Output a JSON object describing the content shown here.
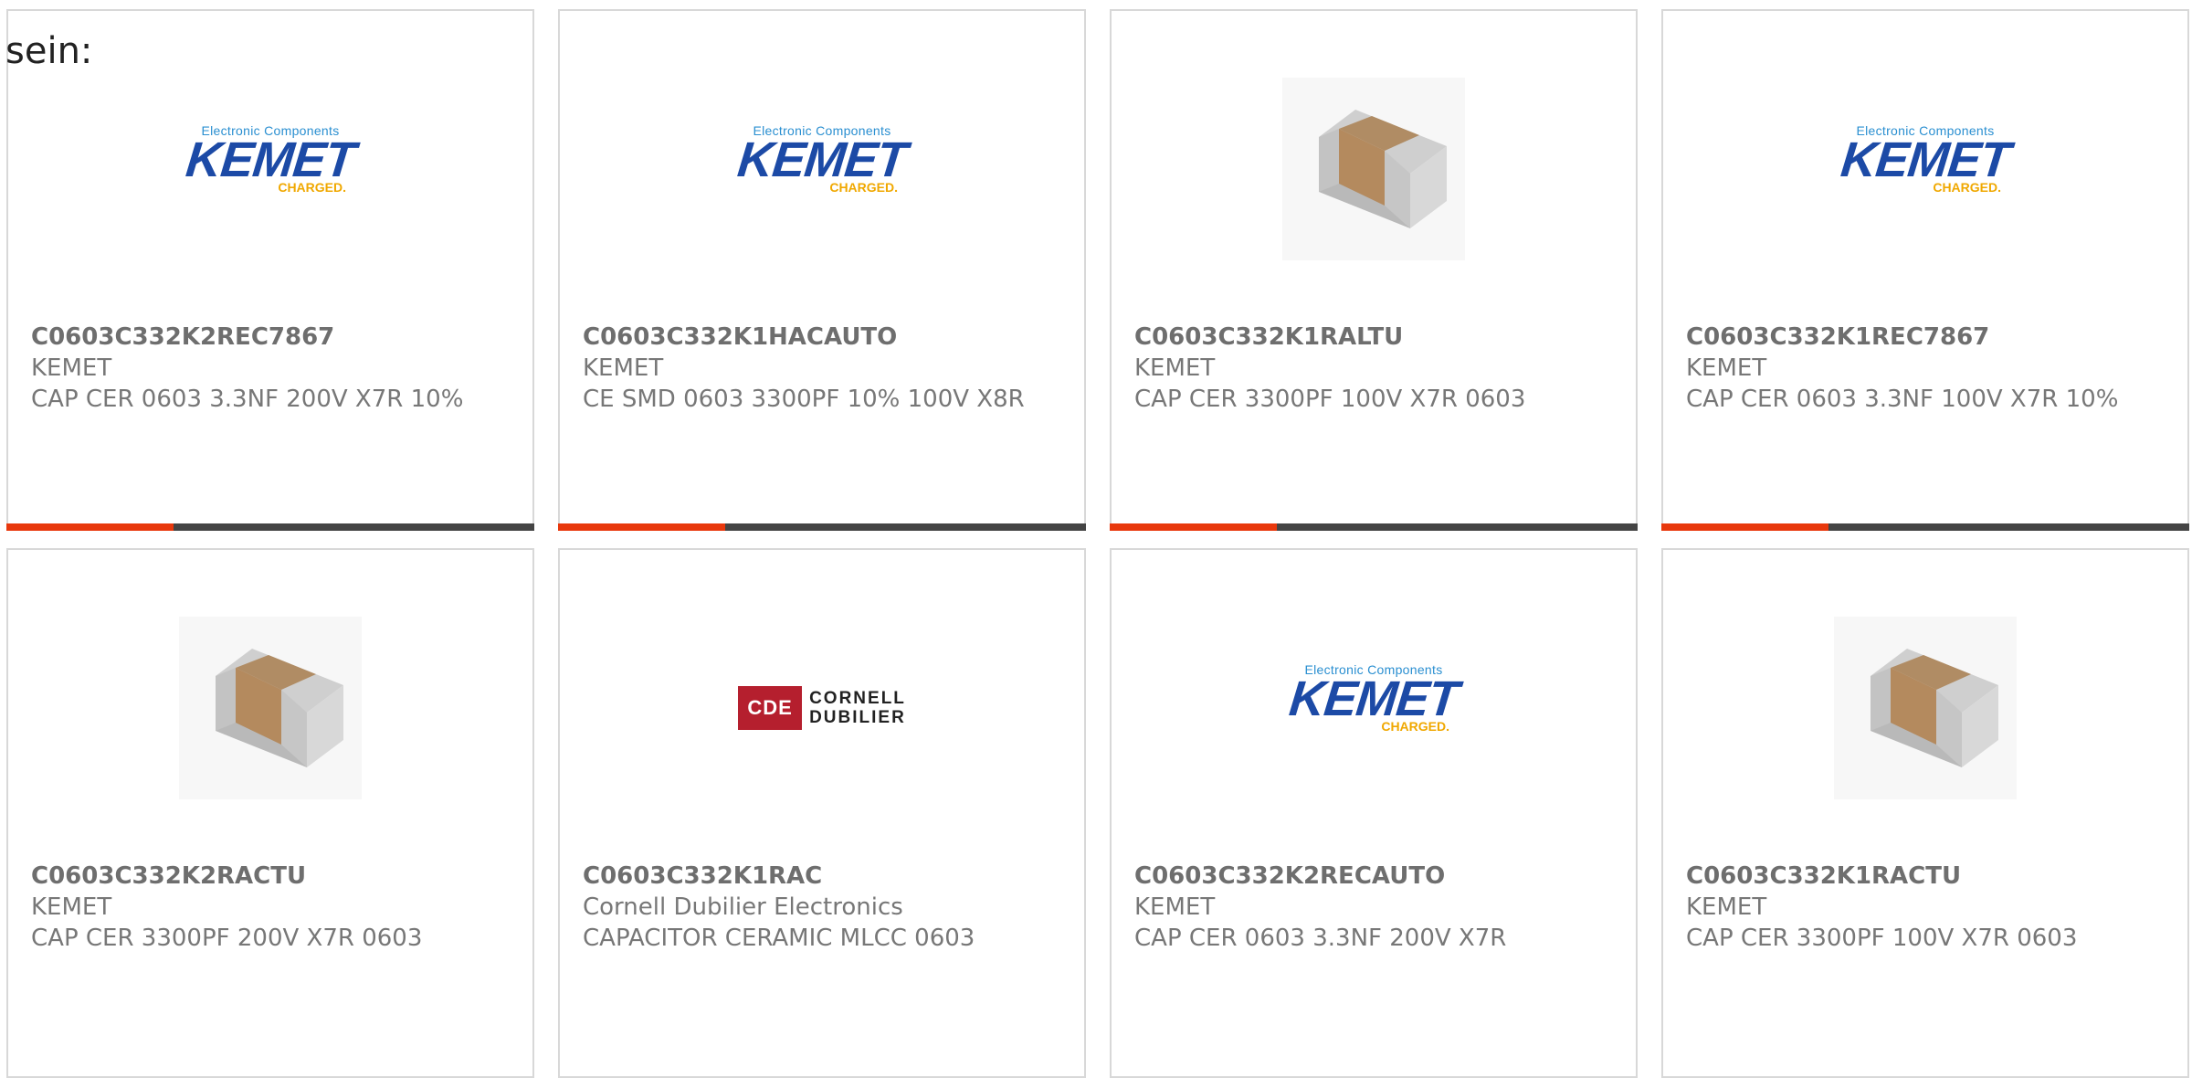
{
  "intro_text": "sein:",
  "colors": {
    "accent": "#e8380d",
    "bar": "#444444",
    "kemet_blue": "#1c4aa6",
    "kemet_yellow": "#f0a800",
    "cde_red": "#b51f2e"
  },
  "logos": {
    "kemet": {
      "tagline": "Electronic Components",
      "name": "KEMET",
      "sub": "CHARGED."
    },
    "cde": {
      "box": "CDE",
      "line1": "CORNELL",
      "line2": "DUBILIER"
    }
  },
  "products": [
    {
      "image": "kemet-logo",
      "part_number": "C0603C332K2REC7867",
      "manufacturer": "KEMET",
      "description": "CAP CER 0603 3.3NF 200V X7R 10%"
    },
    {
      "image": "kemet-logo",
      "part_number": "C0603C332K1HACAUTO",
      "manufacturer": "KEMET",
      "description": "CE SMD 0603 3300PF 10% 100V X8R"
    },
    {
      "image": "chip-capacitor-photo",
      "part_number": "C0603C332K1RALTU",
      "manufacturer": "KEMET",
      "description": "CAP CER 3300PF 100V X7R 0603"
    },
    {
      "image": "kemet-logo",
      "part_number": "C0603C332K1REC7867",
      "manufacturer": "KEMET",
      "description": "CAP CER 0603 3.3NF 100V X7R 10%"
    },
    {
      "image": "chip-capacitor-photo",
      "part_number": "C0603C332K2RACTU",
      "manufacturer": "KEMET",
      "description": "CAP CER 3300PF 200V X7R 0603"
    },
    {
      "image": "cde-logo",
      "part_number": "C0603C332K1RAC",
      "manufacturer": "Cornell Dubilier Electronics",
      "description": "CAPACITOR CERAMIC MLCC 0603"
    },
    {
      "image": "kemet-logo",
      "part_number": "C0603C332K2RECAUTO",
      "manufacturer": "KEMET",
      "description": "CAP CER 0603 3.3NF 200V X7R"
    },
    {
      "image": "chip-capacitor-photo",
      "part_number": "C0603C332K1RACTU",
      "manufacturer": "KEMET",
      "description": "CAP CER 3300PF 100V X7R 0603"
    }
  ]
}
